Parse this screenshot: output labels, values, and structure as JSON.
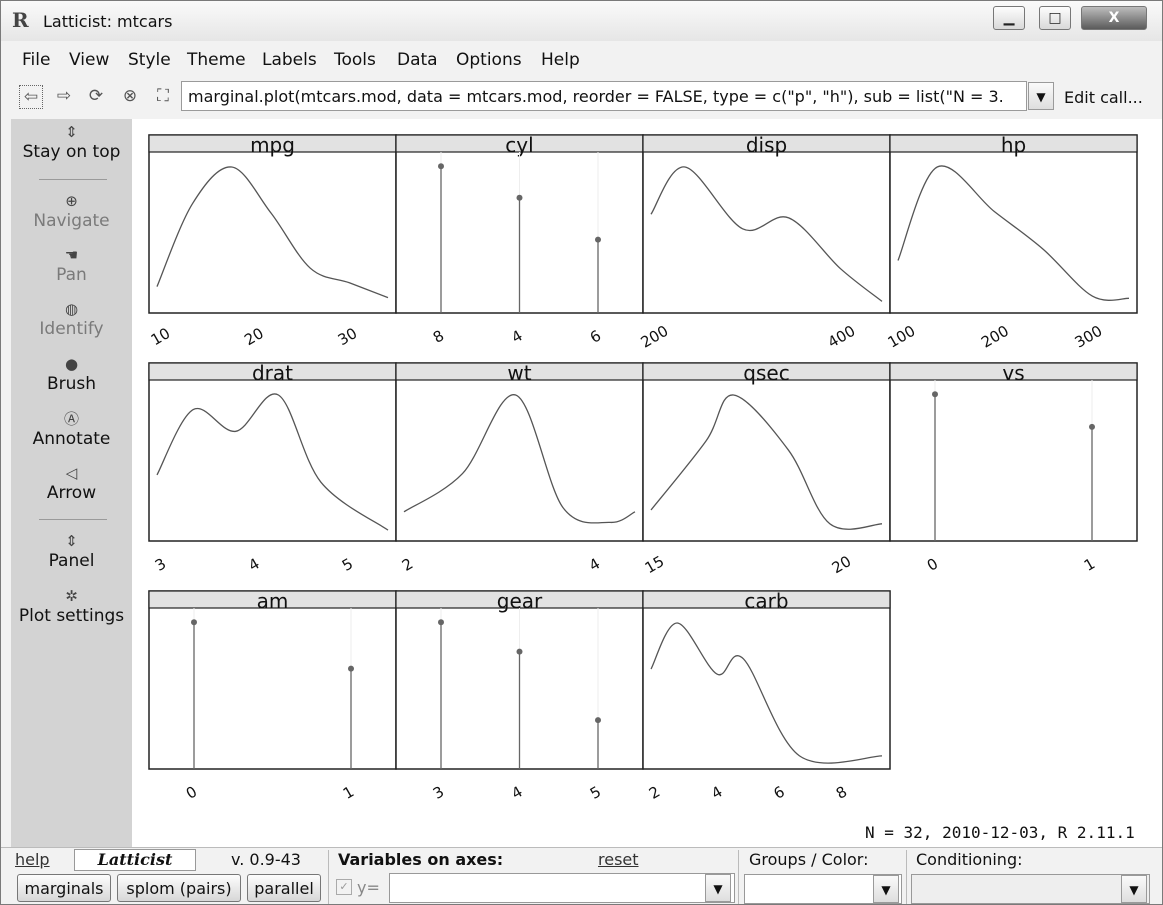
{
  "window": {
    "title": "Latticist: mtcars",
    "app_icon": "R",
    "minimize": "▁",
    "maximize": "□",
    "close": "X"
  },
  "menu": [
    "File",
    "View",
    "Style",
    "Theme",
    "Labels",
    "Tools",
    "Data",
    "Options",
    "Help"
  ],
  "toolbar": {
    "icons": [
      "back-icon",
      "forward-icon",
      "refresh-icon",
      "stop-icon",
      "fit-icon"
    ],
    "call_text": "marginal.plot(mtcars.mod, data = mtcars.mod, reorder = FALSE, type = c(\"p\", \"h\"), sub = list(\"N = 3.",
    "edit_call": "Edit call..."
  },
  "sidebar": {
    "stay_on_top": "Stay on top",
    "navigate": "Navigate",
    "pan": "Pan",
    "identify": "Identify",
    "brush": "Brush",
    "annotate": "Annotate",
    "arrow": "Arrow",
    "panel": "Panel",
    "plot_settings": "Plot settings"
  },
  "plot": {
    "subtitle": "N = 32, 2010-12-03, R 2.11.1"
  },
  "chart_data": {
    "type": "line",
    "panels": [
      {
        "name": "mpg",
        "kind": "density",
        "x_ticks": [
          "10",
          "20",
          "30"
        ],
        "x": [
          10.4,
          14,
          18,
          22,
          26,
          30,
          33.9
        ],
        "y": [
          0.01,
          0.055,
          0.075,
          0.05,
          0.02,
          0.012,
          0.004
        ]
      },
      {
        "name": "cyl",
        "kind": "spike",
        "x_ticks": [
          "8",
          "4",
          "6"
        ],
        "categories": [
          "8",
          "4",
          "6"
        ],
        "values": [
          14,
          11,
          7
        ]
      },
      {
        "name": "disp",
        "kind": "density",
        "x_ticks": [
          "200",
          "400"
        ],
        "x": [
          71,
          130,
          230,
          310,
          400,
          472
        ],
        "y": [
          0.0025,
          0.0038,
          0.0021,
          0.0024,
          0.001,
          0.0001
        ]
      },
      {
        "name": "hp",
        "kind": "density",
        "x_ticks": [
          "100",
          "200",
          "300"
        ],
        "x": [
          52,
          100,
          170,
          230,
          290,
          335
        ],
        "y": [
          0.002,
          0.0062,
          0.0042,
          0.0025,
          0.0004,
          0.0003
        ]
      },
      {
        "name": "drat",
        "kind": "density",
        "x_ticks": [
          "3",
          "4",
          "5"
        ],
        "x": [
          2.76,
          3.1,
          3.5,
          3.9,
          4.3,
          4.93
        ],
        "y": [
          0.4,
          0.85,
          0.7,
          0.95,
          0.35,
          0.02
        ]
      },
      {
        "name": "wt",
        "kind": "density",
        "x_ticks": [
          "2",
          "4"
        ],
        "x": [
          1.51,
          2.5,
          3.4,
          4.2,
          5.0,
          5.42
        ],
        "y": [
          0.1,
          0.28,
          0.65,
          0.12,
          0.05,
          0.1
        ]
      },
      {
        "name": "qsec",
        "kind": "density",
        "x_ticks": [
          "15",
          "20"
        ],
        "x": [
          14.5,
          16.5,
          17.5,
          19.5,
          21,
          22.9
        ],
        "y": [
          0.05,
          0.2,
          0.3,
          0.18,
          0.02,
          0.02
        ]
      },
      {
        "name": "vs",
        "kind": "spike",
        "x_ticks": [
          "0",
          "1"
        ],
        "categories": [
          "0",
          "1"
        ],
        "values": [
          18,
          14
        ]
      },
      {
        "name": "am",
        "kind": "spike",
        "x_ticks": [
          "0",
          "1"
        ],
        "categories": [
          "0",
          "1"
        ],
        "values": [
          19,
          13
        ]
      },
      {
        "name": "gear",
        "kind": "spike",
        "x_ticks": [
          "3",
          "4",
          "5"
        ],
        "categories": [
          "3",
          "4",
          "5"
        ],
        "values": [
          15,
          12,
          5
        ]
      },
      {
        "name": "carb",
        "kind": "density",
        "x_ticks": [
          "2",
          "4",
          "6",
          "8"
        ],
        "x": [
          1,
          1.8,
          3,
          3.8,
          5.5,
          8
        ],
        "y": [
          0.18,
          0.27,
          0.17,
          0.2,
          0.01,
          0.01
        ]
      }
    ]
  },
  "bottom": {
    "help": "help",
    "brand": "Latticist",
    "version": "v. 0.9-43",
    "marginals": "marginals",
    "splom": "splom (pairs)",
    "parallel": "parallel",
    "variables_on_axes": "Variables on axes:",
    "reset": "reset",
    "y_label": "y=",
    "groups_color": "Groups / Color:",
    "conditioning": "Conditioning:"
  }
}
